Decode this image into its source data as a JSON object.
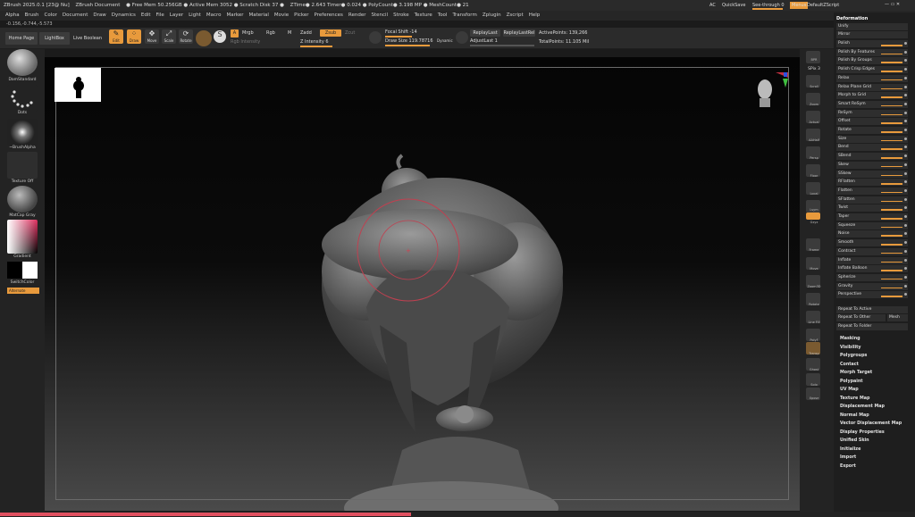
{
  "title_bar": {
    "items": [
      "ZBrush 2025.0.1 [23@ Nu]",
      "ZBrush Document",
      "● Free Mem 50.256GB ● Active Mem 3052 ● Scratch Disk 37 ●",
      "ZTime● 2.643 Timer● 0.024 ● PolyCount● 3.198 MP ● MeshCount● 21"
    ],
    "ac": "AC",
    "quicksave": "QuickSave",
    "seethrough": "See-through  0",
    "menus": "Menus",
    "script": "DefaultZScript"
  },
  "menu": [
    "Alpha",
    "Brush",
    "Color",
    "Document",
    "Draw",
    "Dynamics",
    "Edit",
    "File",
    "Layer",
    "Light",
    "Macro",
    "Marker",
    "Material",
    "Movie",
    "Picker",
    "Preferences",
    "Render",
    "Stencil",
    "Stroke",
    "Texture",
    "Tool",
    "Transform",
    "Zplugin",
    "Zscript",
    "Help"
  ],
  "coords": "-0.156,-0.744,-5.573",
  "toolbar": {
    "home": "Home Page",
    "lightbox": "LightBox",
    "live_boolean": "Live Boolean",
    "edit": "Edit",
    "draw": "Draw",
    "move": "Move",
    "scale": "Scale",
    "rotate": "Rotate",
    "a": "A",
    "mrgb": "Mrgb",
    "rgb": "Rgb",
    "m": "M",
    "zadd": "Zadd",
    "zsub": "Zsub",
    "zcut": "Zcut",
    "rgb_intensity": "Rgb Intensity",
    "z_intensity": "Z Intensity 6",
    "focal_shift": "Focal Shift -14",
    "draw_size": "Draw Size 119.78716",
    "dynamic": "Dynamic",
    "replay_last": "ReplayLast",
    "replay_last_rel": "ReplayLastRel",
    "adjust_last": "AdjustLast 1",
    "active_points": "ActivePoints: 139,266",
    "total_points": "TotalPoints: 11.105 Mil"
  },
  "left_shelf": {
    "brush": "DamStandard",
    "stroke": "Dots",
    "alpha": "~BrushAlpha",
    "texture": "Texture Off",
    "material": "MatCap Gray",
    "gradient": "Gradient",
    "switch": "SwitchColor",
    "alternate": "Alternate"
  },
  "right_shelf": [
    "BPR",
    "SPix 3",
    "Scroll",
    "Zoom",
    "Actual",
    "AAHalf",
    "Persp",
    "Floor",
    "Local",
    "Lsym",
    "Gxyz",
    "Frame",
    "Move",
    "Zoom3D",
    "Rotate",
    "Line Fill",
    "PolyF",
    "Transp",
    "Ghost",
    "Solo",
    "Xpose"
  ],
  "deformation": {
    "title": "Deformation",
    "unify": "Unify",
    "mirror": "Mirror",
    "rows": [
      "Polish",
      "Polish By Features",
      "Polish By Groups",
      "Polish Crisp Edges",
      "Relax",
      "Relax Plane Grid",
      "Morph to Grid",
      "Smart ReSym",
      "ReSym",
      "Offset",
      "Rotate",
      "Size",
      "Bend",
      "SBend",
      "Skew",
      "SSkew",
      "RFlatten",
      "Flatten",
      "SFlatten",
      "Twist",
      "Taper",
      "Squeeze",
      "Noise",
      "Smooth",
      "Contract",
      "Inflate",
      "Inflate Balloon",
      "Spherize",
      "Gravity",
      "Perspective"
    ],
    "repeat_active": "Repeat To Active",
    "repeat_other": "Repeat To Other",
    "mesh": "Mesh",
    "repeat_folder": "Repeat To Folder"
  },
  "subpalettes": [
    "Masking",
    "Visibility",
    "Polygroups",
    "Contact",
    "Morph Target",
    "Polypaint",
    "UV Map",
    "Texture Map",
    "Displacement Map",
    "Normal Map",
    "Vector Displacement Map",
    "Display Properties",
    "Unified Skin",
    "Initialize",
    "Import",
    "Export"
  ],
  "colors": {
    "accent": "#e89a3c",
    "progress": "#e05060"
  }
}
